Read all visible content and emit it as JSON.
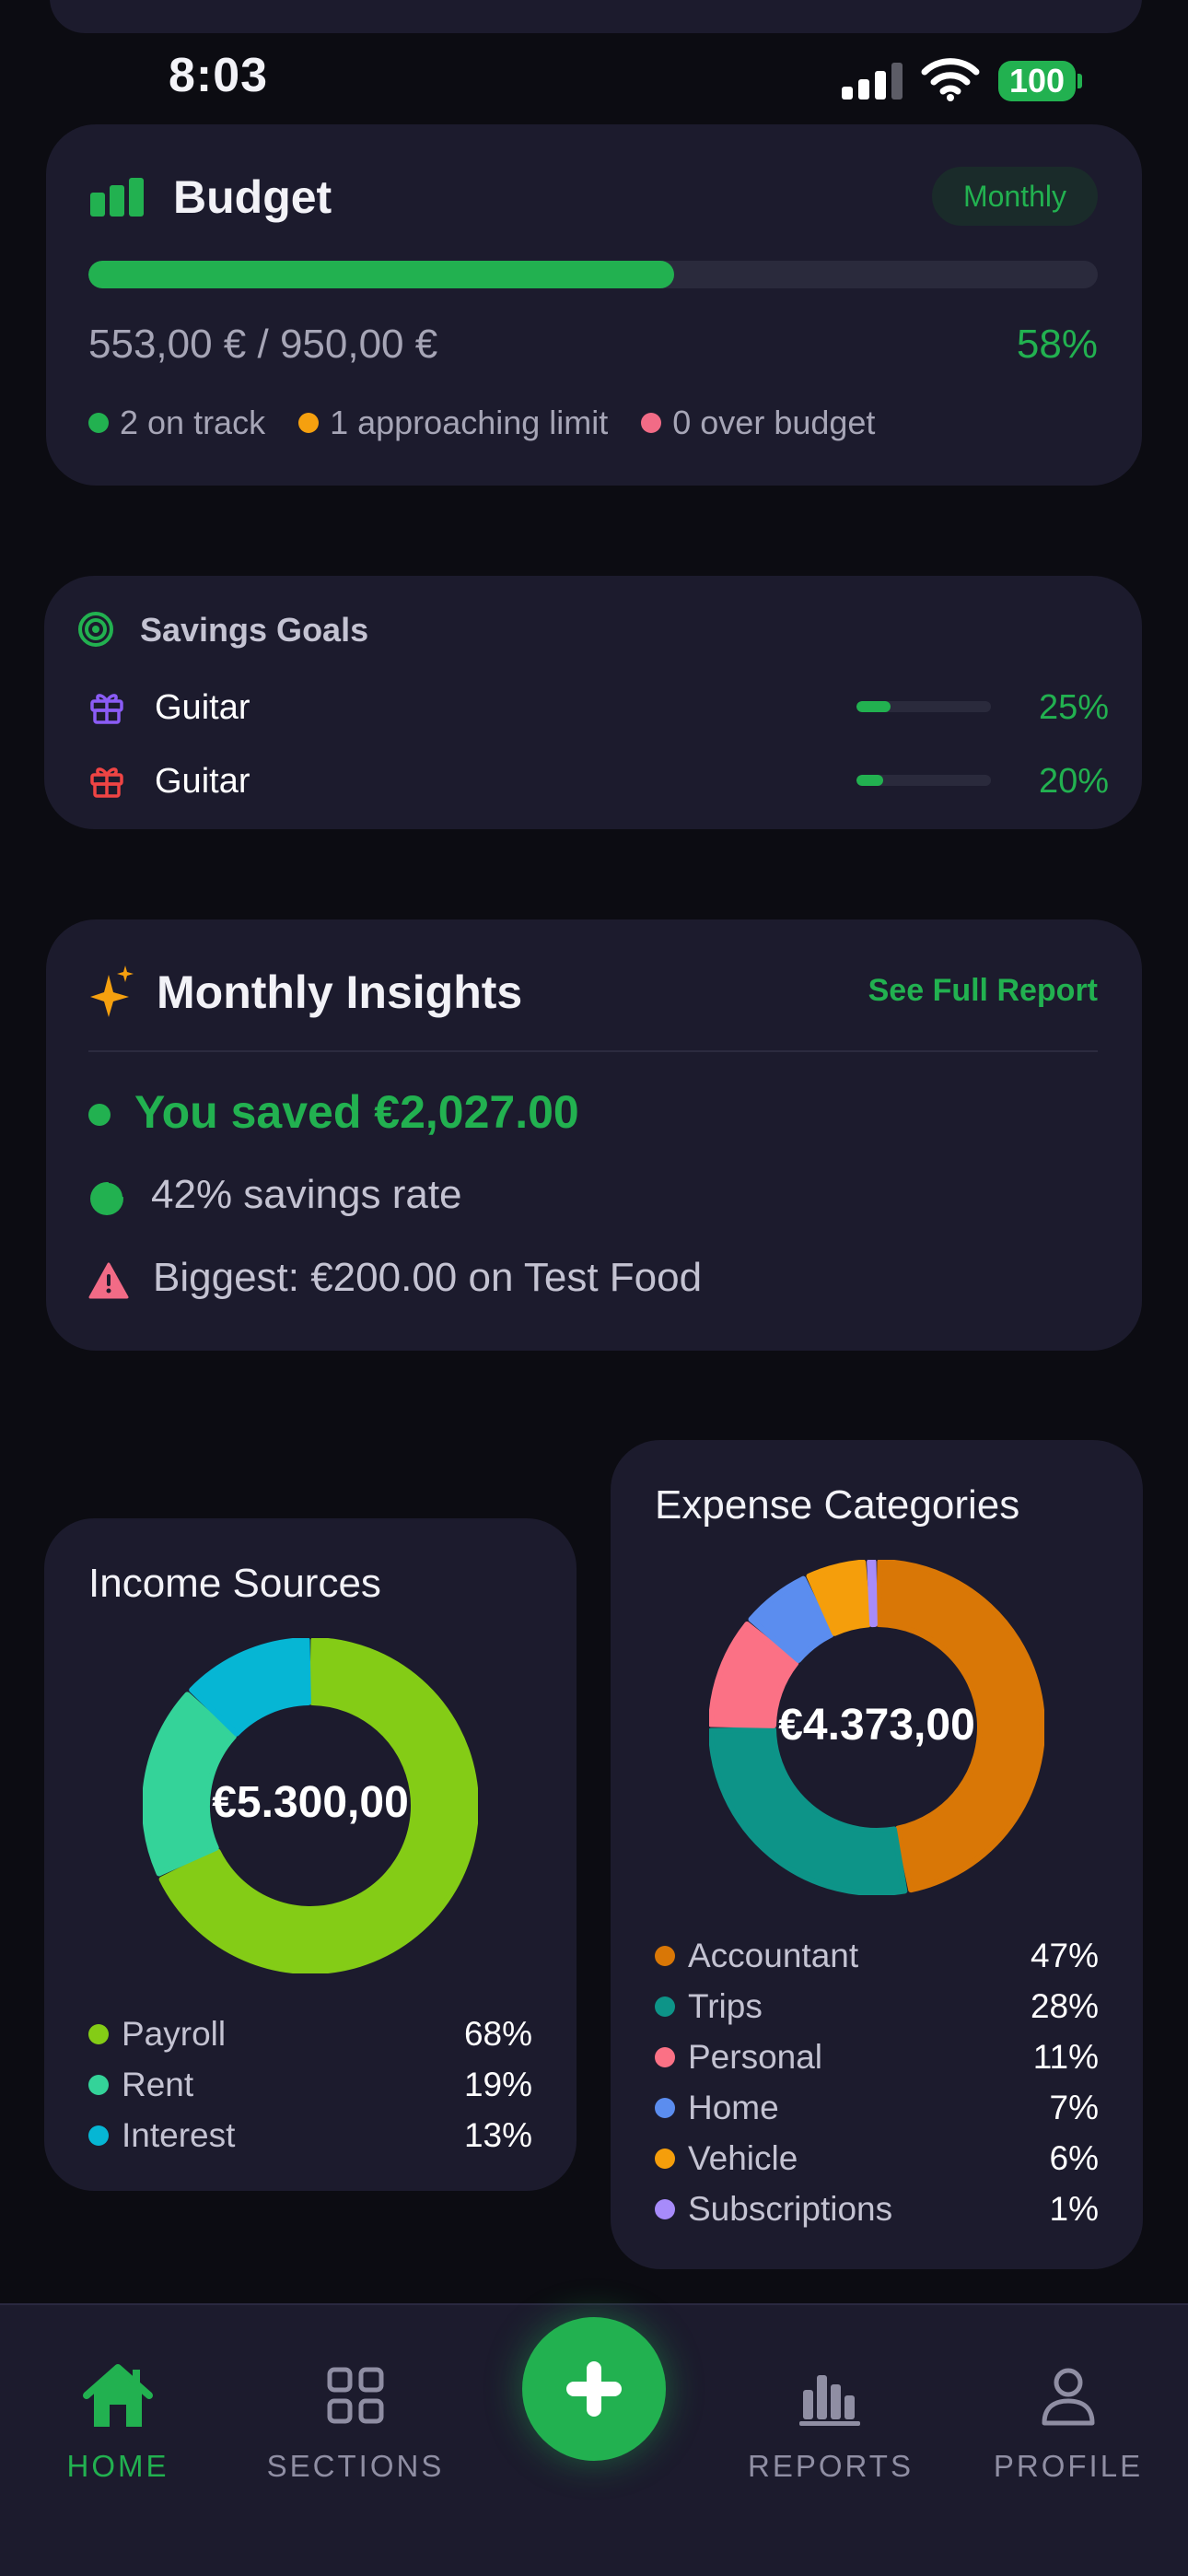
{
  "status_bar": {
    "time": "8:03",
    "battery": "100"
  },
  "budget": {
    "title": "Budget",
    "period": "Monthly",
    "progress": 0.58,
    "amount": "553,00 € / 950,00 €",
    "percent": "58%",
    "legend": [
      {
        "label": "2 on track",
        "color": "#22b150"
      },
      {
        "label": "1 approaching limit",
        "color": "#f5a00f"
      },
      {
        "label": "0 over budget",
        "color": "#f26b86"
      }
    ]
  },
  "savings_goals": {
    "title": "Savings Goals",
    "goals": [
      {
        "name": "Guitar",
        "percent": "25%",
        "progress": 0.25,
        "icon": "gift-icon",
        "color": "#8b5cf6"
      },
      {
        "name": "Guitar",
        "percent": "20%",
        "progress": 0.2,
        "icon": "gift-icon",
        "color": "#ef4444"
      }
    ]
  },
  "insights": {
    "title": "Monthly Insights",
    "link": "See Full Report",
    "saved": "You saved €2,027.00",
    "rate": "42% savings rate",
    "biggest": "Biggest: €200.00 on Test Food"
  },
  "income": {
    "title": "Income Sources",
    "total": "€5.300,00",
    "items": [
      {
        "label": "Payroll",
        "value": "68%",
        "share": 68,
        "color": "#84cc16"
      },
      {
        "label": "Rent",
        "value": "19%",
        "share": 19,
        "color": "#34d399"
      },
      {
        "label": "Interest",
        "value": "13%",
        "share": 13,
        "color": "#06b6d4"
      }
    ]
  },
  "expenses": {
    "title": "Expense Categories",
    "total": "€4.373,00",
    "items": [
      {
        "label": "Accountant",
        "value": "47%",
        "share": 47,
        "color": "#d97706"
      },
      {
        "label": "Trips",
        "value": "28%",
        "share": 28,
        "color": "#0d9488"
      },
      {
        "label": "Personal",
        "value": "11%",
        "share": 11,
        "color": "#fb7185"
      },
      {
        "label": "Home",
        "value": "7%",
        "share": 7,
        "color": "#5b8def"
      },
      {
        "label": "Vehicle",
        "value": "6%",
        "share": 6,
        "color": "#f59e0b"
      },
      {
        "label": "Subscriptions",
        "value": "1%",
        "share": 1,
        "color": "#a78bfa"
      }
    ]
  },
  "nav": {
    "home": "HOME",
    "sections": "SECTIONS",
    "reports": "REPORTS",
    "profile": "PROFILE"
  }
}
